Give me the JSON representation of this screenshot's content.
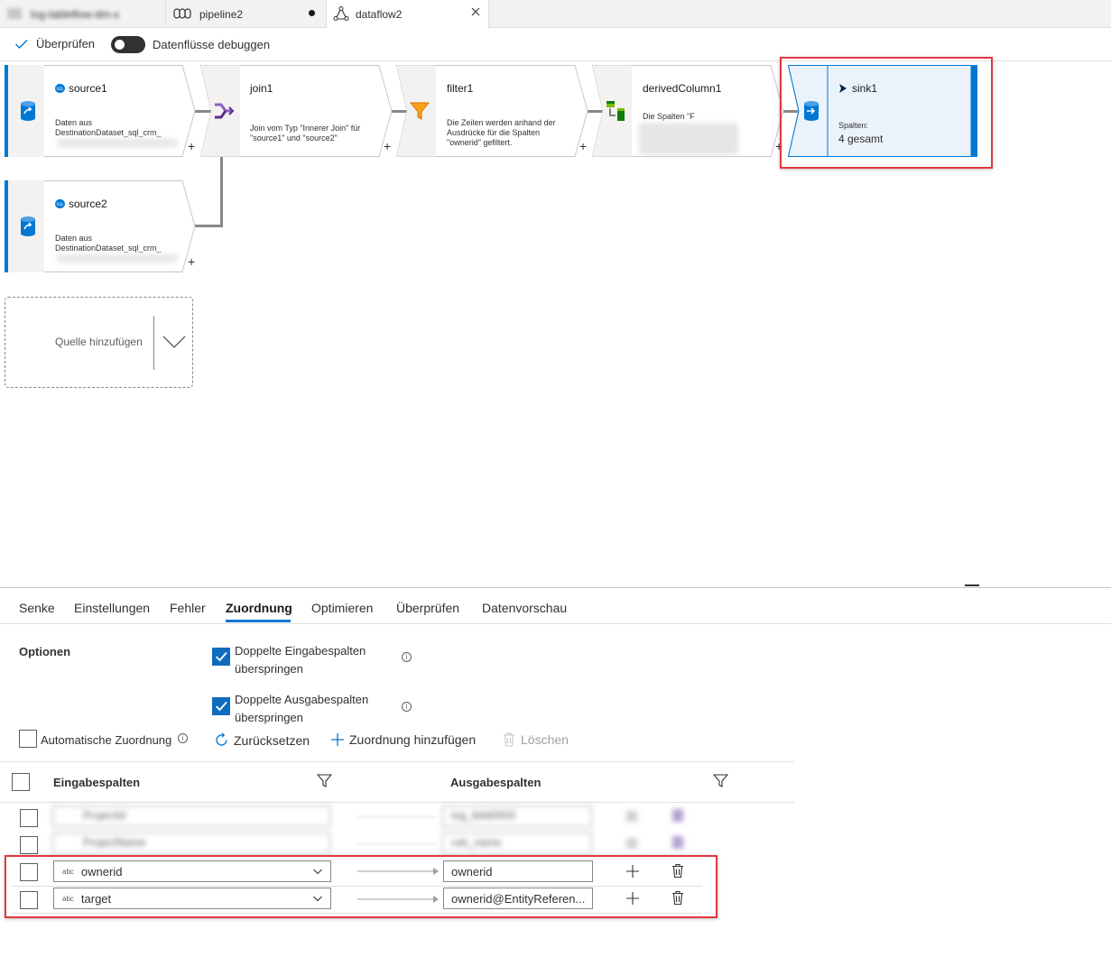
{
  "tabs": [
    {
      "label": "log-tableflow-dm-x"
    },
    {
      "label": "pipeline2",
      "unsaved": true
    },
    {
      "label": "dataflow2",
      "active": true
    }
  ],
  "toolbar": {
    "validate_label": "Überprüfen",
    "debug_label": "Datenflüsse debuggen",
    "debug_enabled": false
  },
  "nodes": {
    "source1": {
      "title": "source1",
      "desc": "Daten aus DestinationDataset_sql_crm_"
    },
    "source2": {
      "title": "source2",
      "desc": "Daten aus DestinationDataset_sql_crm_"
    },
    "join1": {
      "title": "join1",
      "desc": "Join vom Typ \"Innerer Join\" für \"source1\" und \"source2\""
    },
    "filter1": {
      "title": "filter1",
      "desc": "Die Zeilen werden anhand der Ausdrücke für die Spalten \"ownerid\" gefiltert."
    },
    "derived1": {
      "title": "derivedColumn1",
      "desc": "Die Spalten \"F"
    },
    "sink1": {
      "title": "sink1",
      "label": "Spalten:",
      "count": "4 gesamt"
    }
  },
  "plus_symbol": "+",
  "add_source_label": "Quelle hinzufügen",
  "panel": {
    "tabs": [
      "Senke",
      "Einstellungen",
      "Fehler",
      "Zuordnung",
      "Optimieren",
      "Überprüfen",
      "Datenvorschau"
    ],
    "active_tab": "Zuordnung",
    "options_label": "Optionen",
    "skip_dup_input_1": "Doppelte Eingabespalten",
    "skip_dup_input_2": "überspringen",
    "skip_dup_output_1": "Doppelte Ausgabespalten",
    "skip_dup_output_2": "überspringen",
    "auto_mapping_label": "Automatische Zuordnung",
    "auto_mapping_checked": false,
    "reset_label": "Zurücksetzen",
    "add_mapping_label": "Zuordnung hinzufügen",
    "delete_label": "Löschen",
    "input_header": "Eingabespalten",
    "output_header": "Ausgabespalten",
    "type_abbrev": "abc",
    "rows": [
      {
        "input": "ProjectId",
        "output": "log_tblid0000",
        "blurred": true
      },
      {
        "input": "ProjectName",
        "output": "cds_name",
        "blurred": true
      },
      {
        "input": "ownerid",
        "output": "ownerid",
        "blurred": false
      },
      {
        "input": "target",
        "output": "ownerid@EntityReferen...",
        "blurred": false
      }
    ]
  },
  "colors": {
    "accent": "#0078d4",
    "highlight": "#e0393e",
    "node_selected": "#eaf3fc"
  }
}
